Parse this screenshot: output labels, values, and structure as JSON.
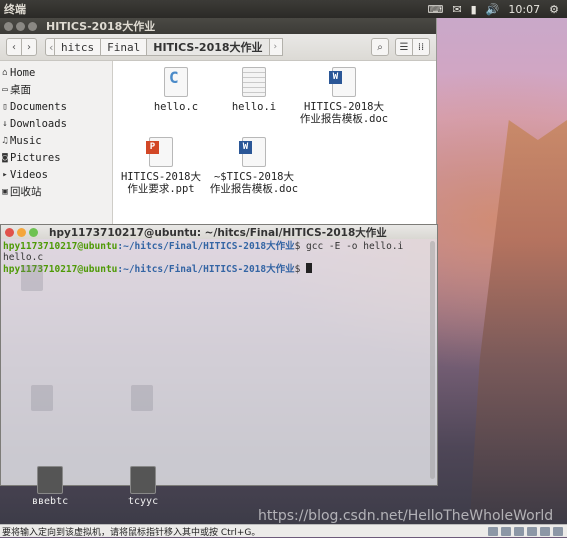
{
  "top_panel": {
    "app_name": "终端",
    "tray": {
      "input_method": "⌨",
      "mail": "✉",
      "battery": "▮",
      "volume": "🔊",
      "time": "10:07",
      "settings": "⚙"
    }
  },
  "file_manager": {
    "window_title": "HITICS-2018大作业",
    "breadcrumbs": [
      "hitcs",
      "Final",
      "HITICS-2018大作业"
    ],
    "sidebar": [
      {
        "icon": "home-icon",
        "glyph": "⌂",
        "label": "Home"
      },
      {
        "icon": "desktop-icon",
        "glyph": "▭",
        "label": "桌面"
      },
      {
        "icon": "documents-icon",
        "glyph": "▯",
        "label": "Documents"
      },
      {
        "icon": "downloads-icon",
        "glyph": "↓",
        "label": "Downloads"
      },
      {
        "icon": "music-icon",
        "glyph": "♫",
        "label": "Music"
      },
      {
        "icon": "pictures-icon",
        "glyph": "◙",
        "label": "Pictures"
      },
      {
        "icon": "videos-icon",
        "glyph": "▸",
        "label": "Videos"
      },
      {
        "icon": "trash-icon",
        "glyph": "▣",
        "label": "回收站"
      }
    ],
    "files": [
      {
        "type": "c",
        "name": "hello.c"
      },
      {
        "type": "txt",
        "name": "hello.i"
      },
      {
        "type": "doc",
        "name": "HITICS-2018大作业报告模板.doc"
      },
      {
        "type": "ppt",
        "name": "HITICS-2018大作业要求.ppt"
      },
      {
        "type": "doc",
        "name": "~$TICS-2018大作业报告模板.doc"
      }
    ]
  },
  "terminal": {
    "window_title": "hpy1173710217@ubuntu: ~/hitcs/Final/HITICS-2018大作业",
    "lines": [
      {
        "user": "hpy1173710217@ubuntu",
        "path": ":~/hitcs/Final/HITICS-2018大作业",
        "cmd": "$ gcc -E -o hello.i hello.c"
      },
      {
        "user": "hpy1173710217@ubuntu",
        "path": ":~/hitcs/Final/HITICS-2018大作业",
        "cmd": "$ "
      }
    ]
  },
  "desktop": {
    "icons": [
      {
        "name": "ввеbtc"
      },
      {
        "name": "tcyyc"
      }
    ]
  },
  "status_bar": {
    "hint": "要将输入定向到该虚拟机，请将鼠标指针移入其中或按 Ctrl+G。"
  },
  "watermark": "https://blog.csdn.net/HelloTheWholeWorld"
}
